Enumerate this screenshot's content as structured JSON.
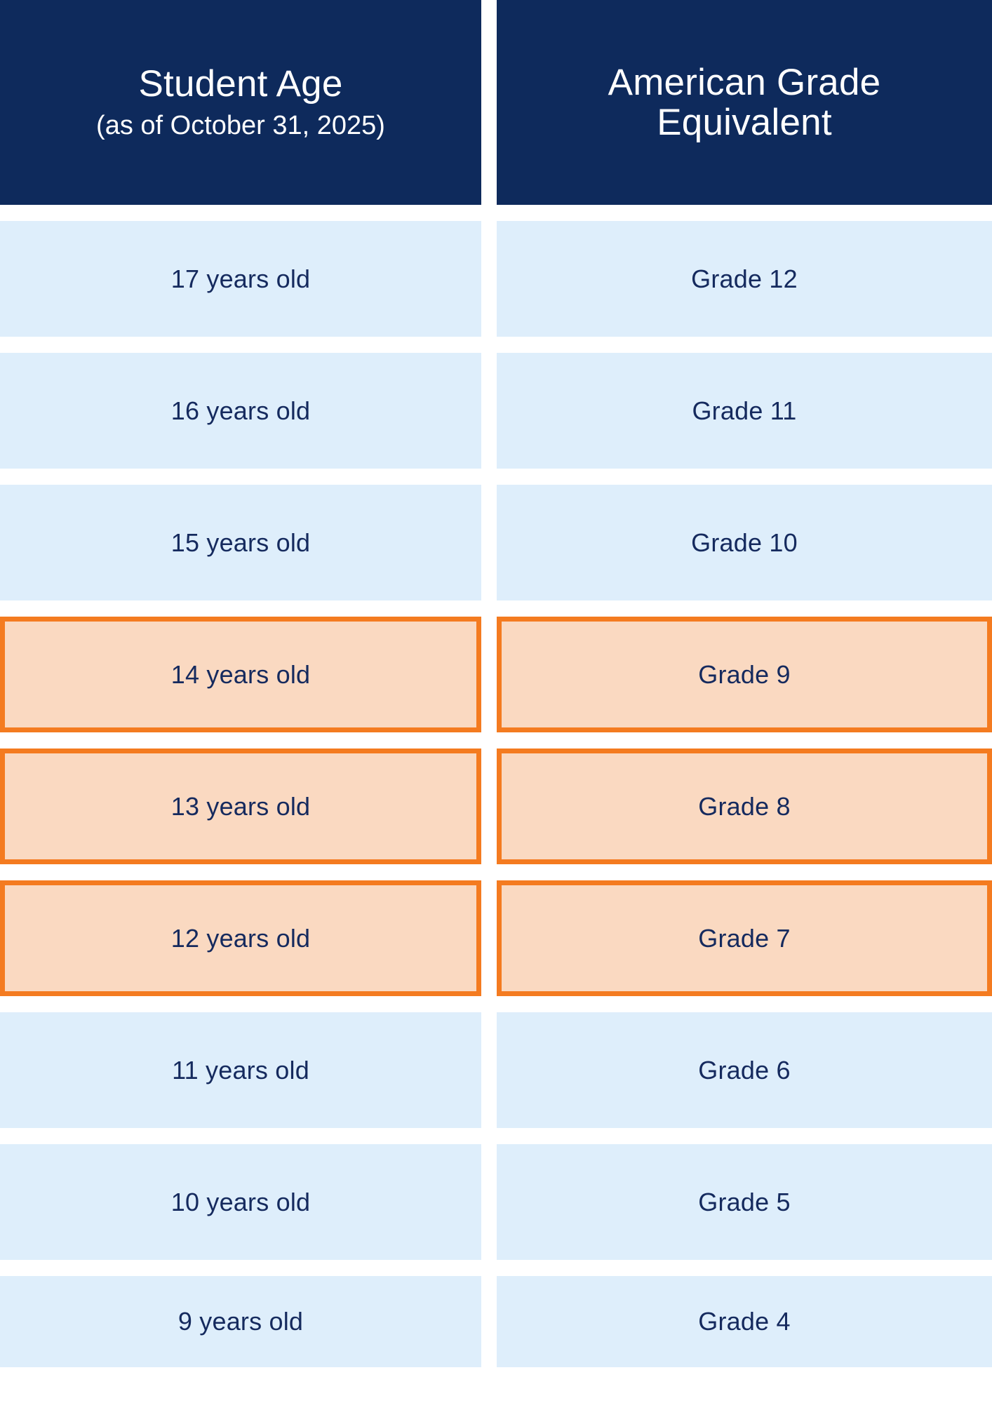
{
  "table": {
    "headers": [
      {
        "title": "Student Age",
        "subtitle": "(as of October 31, 2025)"
      },
      {
        "title": "American Grade Equivalent",
        "subtitle": ""
      }
    ],
    "colors": {
      "header_background": "#0E2A5C",
      "header_text": "#FFFFFF",
      "row_background": "#DEEEFB",
      "row_text": "#152A5E",
      "highlight_background": "#FAD9C1",
      "highlight_border": "#F47B20",
      "page_background": "#FFFFFF"
    },
    "rows": [
      {
        "age": "17 years old",
        "grade": "Grade 12",
        "highlighted": false
      },
      {
        "age": "16 years old",
        "grade": "Grade 11",
        "highlighted": false
      },
      {
        "age": "15 years old",
        "grade": "Grade 10",
        "highlighted": false
      },
      {
        "age": "14 years old",
        "grade": "Grade 9",
        "highlighted": true
      },
      {
        "age": "13 years old",
        "grade": "Grade 8",
        "highlighted": true
      },
      {
        "age": "12 years old",
        "grade": "Grade 7",
        "highlighted": true
      },
      {
        "age": "11 years old",
        "grade": "Grade 6",
        "highlighted": false
      },
      {
        "age": "10 years old",
        "grade": "Grade 5",
        "highlighted": false
      },
      {
        "age": "9 years old",
        "grade": "Grade 4",
        "highlighted": false
      }
    ]
  }
}
